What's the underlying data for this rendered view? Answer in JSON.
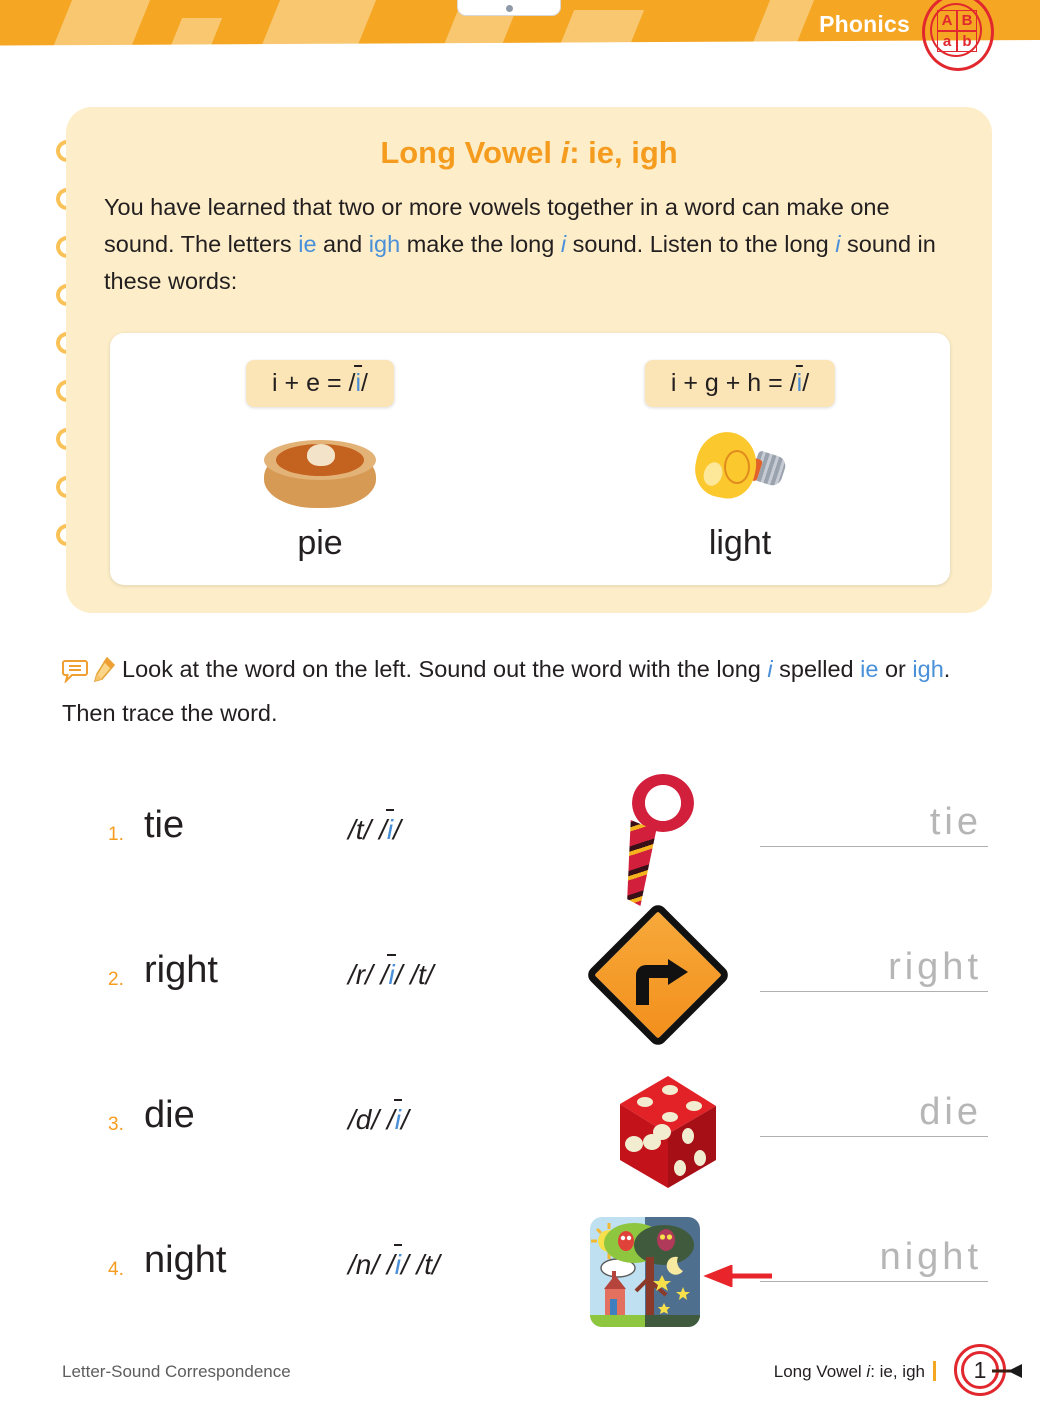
{
  "header": {
    "subject_label": "Phonics",
    "badge_letters": [
      "A",
      "B",
      "a",
      "b"
    ],
    "banner_color": "#f5a623",
    "badge_color": "#e0282e"
  },
  "lesson": {
    "title_prefix": "Long Vowel ",
    "title_italic": "i",
    "title_suffix": ": ie, igh",
    "body": {
      "p1": "You have learned that two or more vowels together in a word can make one sound. The letters ",
      "hl1": "ie",
      "p2": " and ",
      "hl2": "igh",
      "p3": " make the long ",
      "hl3": "i",
      "p4": " sound. Listen to the long ",
      "hl4": "i",
      "p5": " sound in these words:"
    },
    "title_color": "#f59c1f",
    "highlight_color": "#4a90d9",
    "card_color": "#fdeec9"
  },
  "examples": [
    {
      "formula_text": "i + e = /",
      "formula_vowel": "i",
      "formula_close": "/",
      "word": "pie",
      "art": "pie-icon"
    },
    {
      "formula_text": "i + g + h = /",
      "formula_vowel": "i",
      "formula_close": "/",
      "word": "light",
      "art": "lightbulb-icon"
    }
  ],
  "instruction": {
    "icons": [
      "speech-bubble-icon",
      "pencil-icon"
    ],
    "t1": "Look at the word on the left. Sound out the word with the long ",
    "hl1": "i",
    "t2": " spelled ",
    "hl2": "ie",
    "t3": " or ",
    "hl3": "igh",
    "t4": ". Then trace the word."
  },
  "exercises": [
    {
      "number": "1.",
      "word": "tie",
      "phonemes_pre": "/t/ /",
      "phonemes_vowel": "i",
      "phonemes_post": "/",
      "art": "necktie-icon",
      "trace_word": "tie"
    },
    {
      "number": "2.",
      "word": "right",
      "phonemes_pre": "/r/ /",
      "phonemes_vowel": "i",
      "phonemes_post": "/ /t/",
      "art": "right-turn-sign-icon",
      "trace_word": "right"
    },
    {
      "number": "3.",
      "word": "die",
      "phonemes_pre": "/d/ /",
      "phonemes_vowel": "i",
      "phonemes_post": "/",
      "art": "dice-icon",
      "trace_word": "die"
    },
    {
      "number": "4.",
      "word": "night",
      "phonemes_pre": "/n/ /",
      "phonemes_vowel": "i",
      "phonemes_post": "/ /t/",
      "art": "night-scene-icon",
      "trace_word": "night"
    }
  ],
  "footer": {
    "left_label": "Letter-Sound Correspondence",
    "right_prefix": "Long Vowel ",
    "right_italic": "i",
    "right_suffix": ": ie, igh",
    "page_number": "1"
  }
}
